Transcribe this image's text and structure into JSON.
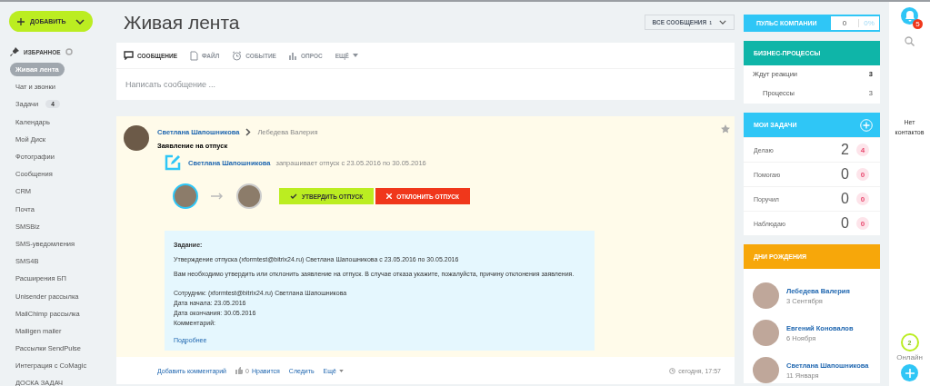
{
  "sidebar": {
    "add_button": "ДОБАВИТЬ",
    "section": "ИЗБРАННОЕ",
    "items": [
      {
        "label": "Живая лента",
        "selected": true
      },
      {
        "label": "Чат и звонки",
        "selected": false
      },
      {
        "label": "Задачи",
        "selected": false,
        "badge": "4"
      },
      {
        "label": "Календарь",
        "selected": false
      },
      {
        "label": "Мой Диск",
        "selected": false
      },
      {
        "label": "Фотографии",
        "selected": false
      },
      {
        "label": "Сообщения",
        "selected": false
      },
      {
        "label": "CRM",
        "selected": false
      },
      {
        "label": "Почта",
        "selected": false
      },
      {
        "label": "SMSBiz",
        "selected": false
      },
      {
        "label": "SMS-уведомления",
        "selected": false
      },
      {
        "label": "SMS4B",
        "selected": false
      },
      {
        "label": "Расширения БП",
        "selected": false
      },
      {
        "label": "Unisender рассылка",
        "selected": false
      },
      {
        "label": "MailChimp рассылка",
        "selected": false
      },
      {
        "label": "Mailigen mailer",
        "selected": false
      },
      {
        "label": "Рассылки SendPulse",
        "selected": false
      },
      {
        "label": "Интеграция с CoMagic",
        "selected": false
      },
      {
        "label": "ДОСКА ЗАДАЧ",
        "selected": false
      }
    ]
  },
  "header": {
    "title": "Живая лента",
    "filter": "ВСЕ СООБЩЕНИЯ",
    "filter_count": "1"
  },
  "composer": {
    "tabs": [
      {
        "kind": "message",
        "label": "СООБЩЕНИЕ",
        "selected": true
      },
      {
        "kind": "file",
        "label": "ФАЙЛ",
        "selected": false
      },
      {
        "kind": "event",
        "label": "СОБЫТИЕ",
        "selected": false
      },
      {
        "kind": "poll",
        "label": "ОПРОС",
        "selected": false
      },
      {
        "kind": "more",
        "label": "ЕЩЁ",
        "selected": false
      }
    ],
    "placeholder": "Написать сообщение ..."
  },
  "post": {
    "author": "Светлана Шапошникова",
    "recipient": "Лебедева Валерия",
    "title": "Заявление на отпуск",
    "request": {
      "author": "Светлана Шапошникова",
      "text": "запрашивает отпуск с 23.05.2016 по 30.05.2016"
    },
    "approve": "УТВЕРДИТЬ ОТПУСК",
    "reject": "ОТКЛОНИТЬ ОТПУСК",
    "task": {
      "heading": "Задание:",
      "lines": [
        "Утверждение отпуска (xformtest@bitrix24.ru) Светлана Шапошникова с 23.05.2016 по 30.05.2016",
        "Вам необходимо утвердить или отклонить заявление на отпуск. В случае отказа укажите, пожалуйста, причину отклонения заявления."
      ],
      "fields": [
        "Сотрудник: (xformtest@bitrix24.ru) Светлана Шапошникова",
        "Дата начала: 23.05.2016",
        "Дата окончания: 30.05.2016",
        "Комментарий:"
      ],
      "link": "Подробнее"
    },
    "footer": {
      "comment": "Добавить комментарий",
      "likes": "0",
      "like": "Нравится",
      "follow": "Следить",
      "more": "Ещё",
      "time": "сегодня, 17:57"
    }
  },
  "pulse": {
    "label": "ПУЛЬС КОМПАНИИ",
    "count": "0",
    "percent": "0%"
  },
  "business_processes": {
    "title": "БИЗНЕС-ПРОЦЕССЫ",
    "rows": [
      {
        "label": "Ждут реакции",
        "value": "3"
      },
      {
        "label": "Процессы",
        "value": "3"
      }
    ]
  },
  "my_tasks": {
    "title": "МОИ ЗАДАЧИ",
    "rows": [
      {
        "label": "Делаю",
        "count": "2",
        "badge": "4"
      },
      {
        "label": "Помогаю",
        "count": "0",
        "badge": "0"
      },
      {
        "label": "Поручил",
        "count": "0",
        "badge": "0"
      },
      {
        "label": "Наблюдаю",
        "count": "0",
        "badge": "0"
      }
    ]
  },
  "birthdays": {
    "title": "ДНИ РОЖДЕНИЯ",
    "people": [
      {
        "name": "Лебедева Валерия",
        "date": "3 Сентября"
      },
      {
        "name": "Евгений Коновалов",
        "date": "6 Ноября"
      },
      {
        "name": "Светлана Шапошникова",
        "date": "11 Января"
      }
    ]
  },
  "contacts": {
    "notifications": "5",
    "empty": "Нет контактов",
    "online_count": "2",
    "online_label": "Онлайн"
  }
}
